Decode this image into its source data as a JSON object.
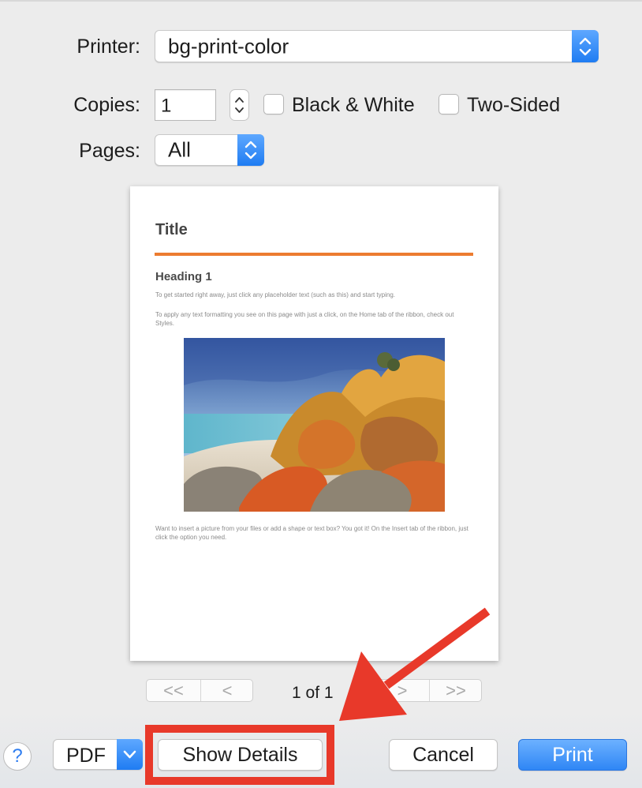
{
  "printer": {
    "label": "Printer:",
    "value": "bg-print-color"
  },
  "copies": {
    "label": "Copies:",
    "value": "1"
  },
  "options": {
    "black_white": "Black & White",
    "black_white_checked": false,
    "two_sided": "Two-Sided",
    "two_sided_checked": false
  },
  "pages": {
    "label": "Pages:",
    "value": "All"
  },
  "preview": {
    "title": "Title",
    "heading": "Heading 1",
    "para1": "To get started right away, just click any placeholder text (such as this) and start typing.",
    "para2": "To apply any text formatting you see on this page with just a click, on the Home tab of the ribbon, check out Styles.",
    "para3": "Want to insert a picture from your files or add a shape or text box? You got it! On the Insert tab of the ribbon, just click the option you need.",
    "accent_color": "#ec7c30"
  },
  "navigation": {
    "first": "<<",
    "prev": "<",
    "page_info": "1 of 1",
    "next": ">",
    "last": ">>"
  },
  "buttons": {
    "help": "?",
    "pdf": "PDF",
    "show_details": "Show Details",
    "cancel": "Cancel",
    "print": "Print"
  },
  "colors": {
    "primary_button": "#2f86f5",
    "annotation": "#e8392a"
  }
}
